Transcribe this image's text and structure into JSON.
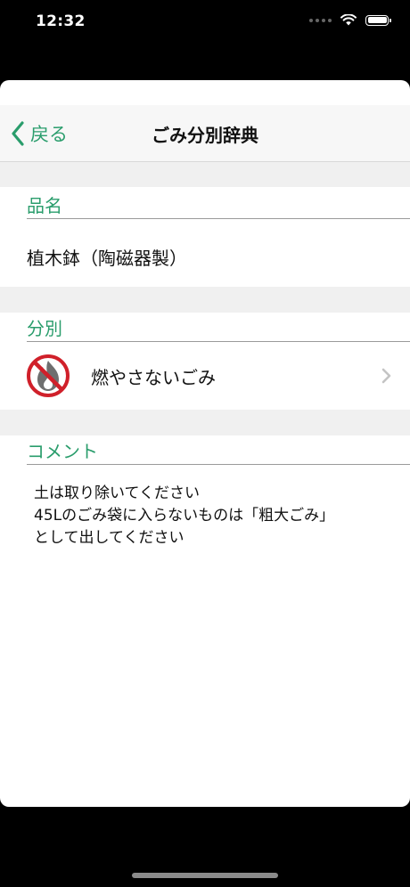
{
  "status_bar": {
    "time": "12:32"
  },
  "nav": {
    "back_label": "戻る",
    "title": "ごみ分別辞典"
  },
  "item_name": {
    "header": "品名",
    "value": "植木鉢（陶磁器製）"
  },
  "category": {
    "header": "分別",
    "value": "燃やさないごみ",
    "icon": "non-burnable-icon"
  },
  "comment": {
    "header": "コメント",
    "lines": [
      "土は取り除いてください",
      "45Lのごみ袋に入らないものは「粗大ごみ」",
      "として出してください"
    ]
  },
  "colors": {
    "accent": "#2a9d6c",
    "prohibit": "#d0202a",
    "icon_fill": "#6f6f6f"
  }
}
